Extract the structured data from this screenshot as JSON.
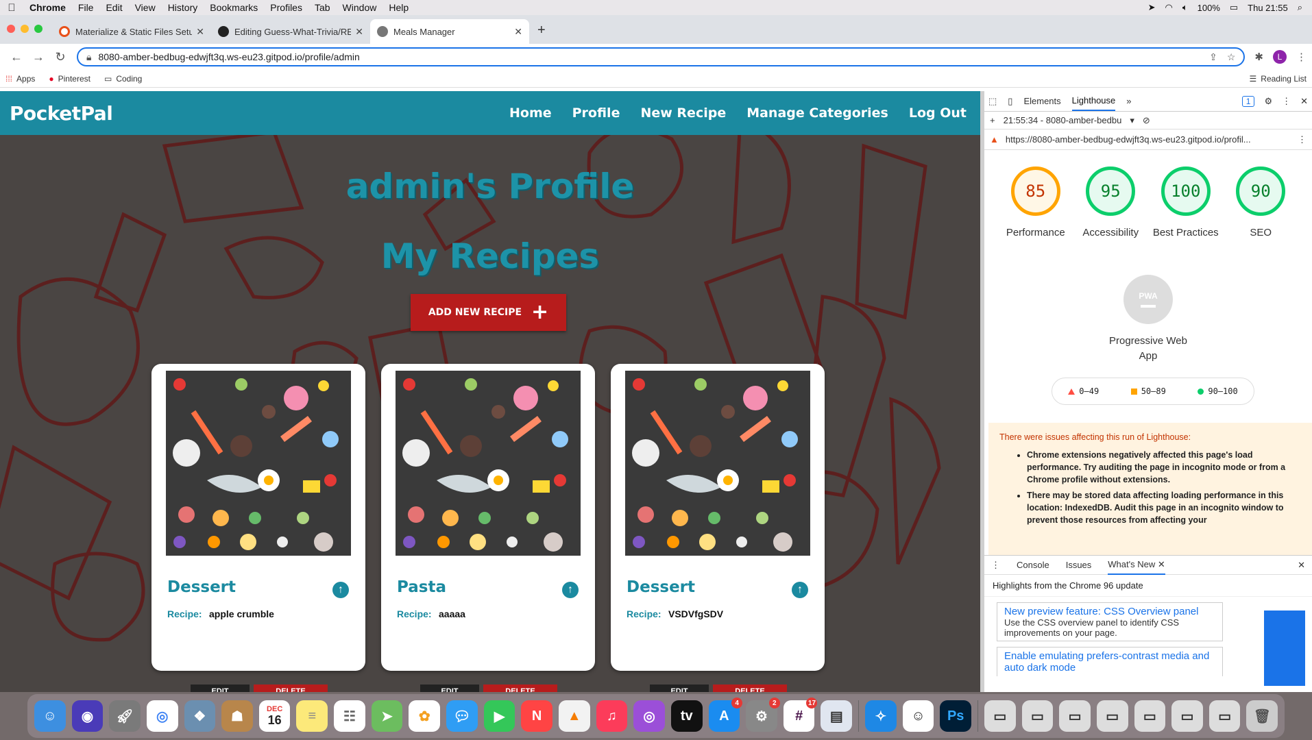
{
  "menubar": {
    "app": "Chrome",
    "items": [
      "File",
      "Edit",
      "View",
      "History",
      "Bookmarks",
      "Profiles",
      "Tab",
      "Window",
      "Help"
    ],
    "battery": "100%",
    "clock": "Thu 21:55"
  },
  "tabs": [
    {
      "title": "Materialize & Static Files Setup",
      "color": "#e8501a",
      "fav": "○"
    },
    {
      "title": "Editing Guess-What-Trivia/README",
      "color": "#222222",
      "fav": "●"
    },
    {
      "title": "Meals Manager",
      "color": "#666666",
      "fav": "◉"
    }
  ],
  "toolbar": {
    "url": "8080-amber-bedbug-edwjft3q.ws-eu23.gitpod.io/profile/admin",
    "avatar": "L"
  },
  "bookmarks": {
    "items": [
      "Apps",
      "Pinterest",
      "Coding"
    ],
    "reading_list": "Reading List"
  },
  "site": {
    "brand": "PocketPal",
    "nav": [
      "Home",
      "Profile",
      "New Recipe",
      "Manage Categories",
      "Log Out"
    ],
    "profile_heading": "admin's Profile",
    "recipes_heading": "My Recipes",
    "add_button": "ADD NEW RECIPE",
    "recipe_label": "Recipe:",
    "cards": [
      {
        "category": "Dessert",
        "recipe": "apple crumble"
      },
      {
        "category": "Pasta",
        "recipe": "aaaaa"
      },
      {
        "category": "Dessert",
        "recipe": "VSDVfgSDV"
      }
    ],
    "edit_label": "EDIT",
    "delete_label": "DELETE"
  },
  "devtools": {
    "tabs": [
      "Elements",
      "Lighthouse"
    ],
    "selected_tab": "Lighthouse",
    "issues_badge": "1",
    "report_time": "21:55:34 - 8080-amber-bedbu",
    "report_url": "https://8080-amber-bedbug-edwjft3q.ws-eu23.gitpod.io/profil...",
    "scores": [
      {
        "label": "Performance",
        "value": "85",
        "level": "orange"
      },
      {
        "label": "Accessibility",
        "value": "95",
        "level": "green"
      },
      {
        "label": "Best Practices",
        "value": "100",
        "level": "green"
      },
      {
        "label": "SEO",
        "value": "90",
        "level": "green"
      }
    ],
    "pwa_badge": "PWA",
    "pwa_label": "Progressive Web App",
    "legend": [
      "0–49",
      "50–89",
      "90–100"
    ],
    "warning_title": "There were issues affecting this run of Lighthouse:",
    "warnings": [
      "Chrome extensions negatively affected this page's load performance. Try auditing the page in incognito mode or from a Chrome profile without extensions.",
      "There may be stored data affecting loading performance in this location: IndexedDB. Audit this page in an incognito window to prevent those resources from affecting your"
    ],
    "drawer_tabs": [
      "Console",
      "Issues",
      "What's New"
    ],
    "drawer_selected": "What's New",
    "highlights": "Highlights from the Chrome 96 update",
    "news": [
      {
        "title": "New preview feature: CSS Overview panel",
        "desc": "Use the CSS overview panel to identify CSS improvements on your page."
      },
      {
        "title": "Enable emulating prefers-contrast media and auto dark mode",
        "desc": ""
      }
    ]
  },
  "dock": {
    "badges": {
      "appstore": "4",
      "settings": "2",
      "slack": "17"
    },
    "calendar_month": "DEC",
    "calendar_day": "16"
  }
}
